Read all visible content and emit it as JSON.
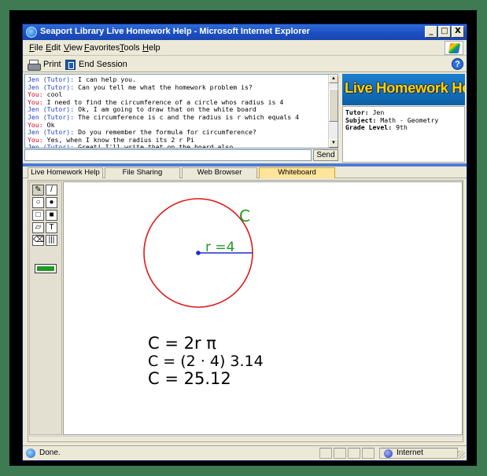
{
  "window": {
    "title": "Seaport Library Live Homework Help - Microsoft Internet Explorer",
    "controls": {
      "minimize": "_",
      "maximize": "□",
      "close": "X"
    }
  },
  "menu": [
    "File",
    "Edit",
    "View",
    "Favorites",
    "Tools",
    "Help"
  ],
  "toolbar": {
    "print_label": "Print",
    "end_session_label": "End Session",
    "help_glyph": "?"
  },
  "chat": {
    "messages": [
      {
        "speaker": "Jen (Tutor):",
        "text": " I can help you.",
        "role": "tutor"
      },
      {
        "speaker": "Jen (Tutor):",
        "text": " Can you tell me what the homework problem is?",
        "role": "tutor"
      },
      {
        "speaker": "You:",
        "text": " cool",
        "role": "you"
      },
      {
        "speaker": "You:",
        "text": " I need to find the circumference of a circle whos radius is 4",
        "role": "you"
      },
      {
        "speaker": "Jen (Tutor):",
        "text": " Ok, I am going to draw that on the white board",
        "role": "tutor"
      },
      {
        "speaker": "Jen (Tutor):",
        "text": " The circumference is c and the radius is r which equals 4",
        "role": "tutor"
      },
      {
        "speaker": "You:",
        "text": " Ok",
        "role": "you"
      },
      {
        "speaker": "Jen (Tutor):",
        "text": " Do you remember the formula for circumference?",
        "role": "tutor"
      },
      {
        "speaker": "You:",
        "text": " Yes, when I know the radius its 2 r Pi",
        "role": "you"
      },
      {
        "speaker": "Jen (Tutor):",
        "text": " Great! I'll write that on the board also.",
        "role": "tutor"
      }
    ],
    "input_value": "",
    "send_label": "Send",
    "scroll_up": "▲",
    "scroll_down": "▼"
  },
  "banner": {
    "text": "Live Homework Help"
  },
  "session_info": {
    "tutor_label": "Tutor:",
    "tutor_value": " Jen",
    "subject_label": "Subject:",
    "subject_value": " Math - Geometry",
    "grade_label": "Grade Level:",
    "grade_value": " 9th"
  },
  "tabs": [
    "Live Homework Help",
    "File Sharing",
    "Web Browser",
    "Whiteboard"
  ],
  "active_tab": "Whiteboard",
  "whiteboard": {
    "tool_glyphs": [
      "✎",
      "/",
      "○",
      "●",
      "□",
      "■",
      "▱",
      "T",
      "⌫",
      "|||"
    ],
    "current_color": "#1d9a22",
    "circle_color": "#e01b1b",
    "radius_color": "#1a2fd0",
    "label_color": "#1d9a22",
    "circle_label": "C",
    "radius_label": "r =4",
    "formulas": [
      "C = 2r π",
      "C = (2 · 4) 3.14",
      "C = 25.12"
    ]
  },
  "status": {
    "text": "Done.",
    "zone": "Internet"
  }
}
